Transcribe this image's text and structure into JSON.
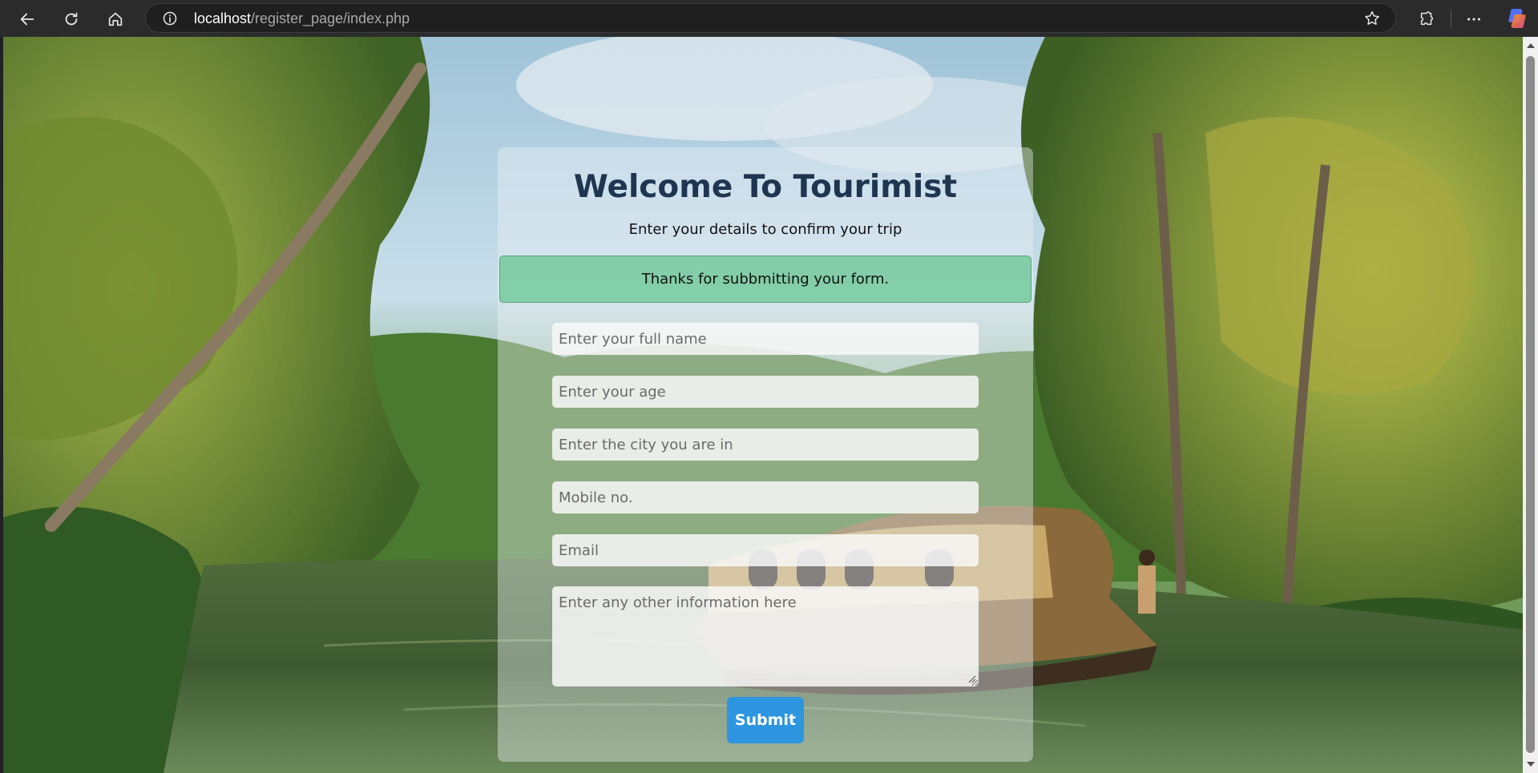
{
  "browser": {
    "url_host": "localhost",
    "url_path": "/register_page/index.php",
    "icons": [
      "back-arrow-icon",
      "reload-icon",
      "home-icon",
      "site-info-icon",
      "favorite-star-icon",
      "extensions-icon",
      "more-options-icon",
      "copilot-icon"
    ]
  },
  "page": {
    "title": "Welcome To Tourimist",
    "subtitle": "Enter your details to confirm your trip",
    "alert": "Thanks for subbmitting your form.",
    "fields": {
      "name_placeholder": "Enter your full name",
      "age_placeholder": "Enter your age",
      "city_placeholder": "Enter the city you are in",
      "mobile_placeholder": "Mobile no.",
      "email_placeholder": "Email",
      "info_placeholder": "Enter any other information here"
    },
    "submit_label": "Submit"
  },
  "colors": {
    "title": "#1f3550",
    "alert_bg": "#6cc896",
    "submit_bg": "#2e95e0"
  }
}
